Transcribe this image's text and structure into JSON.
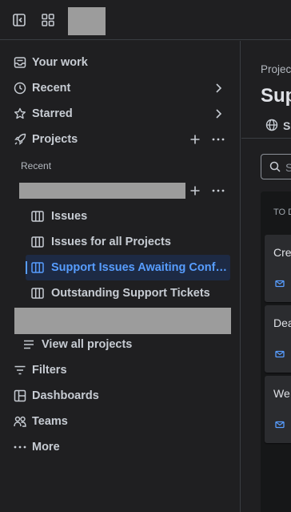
{
  "topbar": {
    "sidebar_toggle_icon": "sidebar-collapse-icon",
    "app_switcher_icon": "app-grid-icon"
  },
  "sidebar": {
    "nav": [
      {
        "label": "Your work",
        "icon": "inbox-icon"
      },
      {
        "label": "Recent",
        "icon": "clock-icon"
      },
      {
        "label": "Starred",
        "icon": "star-icon"
      },
      {
        "label": "Projects",
        "icon": "rocket-icon"
      }
    ],
    "recent_section_label": "Recent",
    "project_items": [
      {
        "label": "Issues",
        "icon": "board-icon"
      },
      {
        "label": "Issues for all Projects",
        "icon": "board-icon"
      },
      {
        "label": "Support Issues Awaiting Confirm...",
        "icon": "board-icon"
      },
      {
        "label": "Outstanding Support Tickets",
        "icon": "board-icon"
      }
    ],
    "view_all_projects": "View all projects",
    "bottom_nav": [
      {
        "label": "Filters",
        "icon": "filter-icon"
      },
      {
        "label": "Dashboards",
        "icon": "dashboard-icon"
      },
      {
        "label": "Teams",
        "icon": "teams-icon"
      },
      {
        "label": "More",
        "icon": "more-icon"
      }
    ]
  },
  "main": {
    "breadcrumb": "Projec",
    "title": "Sup",
    "view_tab_label": "Se",
    "search_placeholder": "S",
    "column_header": "TO D",
    "cards": [
      {
        "title": "Cre"
      },
      {
        "title": "Dea"
      },
      {
        "title": "We"
      }
    ]
  },
  "colors": {
    "background": "#1f1f21",
    "active_text": "#579dff",
    "active_bg": "#1d2a44",
    "text": "#c7ccd3",
    "border": "#3a3d42"
  }
}
